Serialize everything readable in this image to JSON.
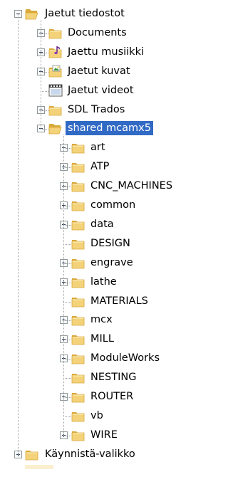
{
  "tree": {
    "root": {
      "label": "Jaetut tiedostot",
      "expanded": true,
      "icon": "folder-open-icon"
    },
    "level1": [
      {
        "label": "Documents",
        "has_children": true,
        "icon": "folder-icon"
      },
      {
        "label": "Jaettu musiikki",
        "has_children": true,
        "icon": "music-folder-icon"
      },
      {
        "label": "Jaetut kuvat",
        "has_children": true,
        "icon": "pictures-folder-icon"
      },
      {
        "label": "Jaetut videot",
        "has_children": false,
        "icon": "video-folder-icon"
      },
      {
        "label": "SDL Trados",
        "has_children": true,
        "icon": "folder-icon"
      },
      {
        "label": "shared mcamx5",
        "has_children": true,
        "expanded": true,
        "selected": true,
        "icon": "folder-open-icon"
      }
    ],
    "level2": [
      {
        "label": "art",
        "has_children": true
      },
      {
        "label": "ATP",
        "has_children": true
      },
      {
        "label": "CNC_MACHINES",
        "has_children": true
      },
      {
        "label": "common",
        "has_children": true
      },
      {
        "label": "data",
        "has_children": true
      },
      {
        "label": "DESIGN",
        "has_children": false
      },
      {
        "label": "engrave",
        "has_children": true
      },
      {
        "label": "lathe",
        "has_children": true
      },
      {
        "label": "MATERIALS",
        "has_children": false
      },
      {
        "label": "mcx",
        "has_children": true
      },
      {
        "label": "MILL",
        "has_children": true
      },
      {
        "label": "ModuleWorks",
        "has_children": true
      },
      {
        "label": "NESTING",
        "has_children": false
      },
      {
        "label": "ROUTER",
        "has_children": true
      },
      {
        "label": "vb",
        "has_children": false
      },
      {
        "label": "WIRE",
        "has_children": true
      }
    ],
    "bottom": {
      "label": "Käynnistä-valikko",
      "has_children": true,
      "icon": "folder-icon"
    }
  },
  "colors": {
    "selection": "#316ac5",
    "folder": "#f3d27a",
    "folder_dark": "#d9a93a"
  }
}
